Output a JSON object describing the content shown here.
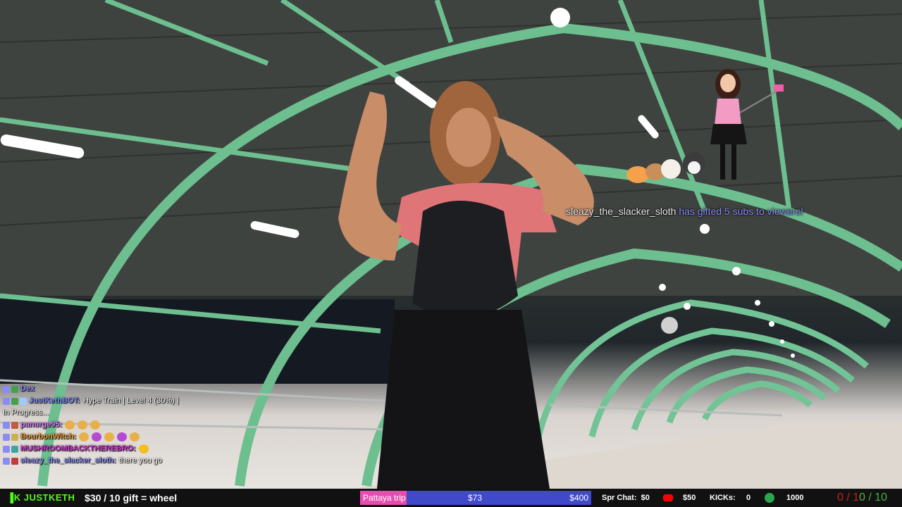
{
  "alert": {
    "username": "sleazy_the_slacker_sloth",
    "message": "has gifted 5 subs to viewers!"
  },
  "chat": [
    {
      "name": "Dex",
      "text": ""
    },
    {
      "name": "JustKethBOT:",
      "text": "Hype Train | Level 4 (30%) |"
    },
    {
      "name": "",
      "text": "In Progress..."
    },
    {
      "name": "panurge95:",
      "text": ""
    },
    {
      "name": "BourbonWitch:",
      "text": ""
    },
    {
      "name": "MUSHROOMBACKTHEREBRO:",
      "text": ""
    },
    {
      "name": "sleazy_the_slacker_sloth:",
      "text": "there you go"
    }
  ],
  "bottom_bar": {
    "logo": "JUSTKETH",
    "gift_goal": "$30 / 10 gift = wheel",
    "goal_name": "Pattaya trip",
    "goal_current": "$73",
    "goal_target": "$400",
    "goal_progress": 0.1825,
    "spr_chat_label": "Spr Chat:",
    "spr_chat_value": "$0",
    "youtube_value": "$50",
    "kicks_label": "KICKs:",
    "kicks_value": "0",
    "kicks_goal": "1000",
    "counter_red": "0 / 10",
    "counter_green": "0 / 10"
  },
  "colors": {
    "kick_green": "#53fc18",
    "goal_bar": "#3f49c9",
    "goal_fill": "#e84cb0",
    "arch_green": "#6dbf8f"
  }
}
